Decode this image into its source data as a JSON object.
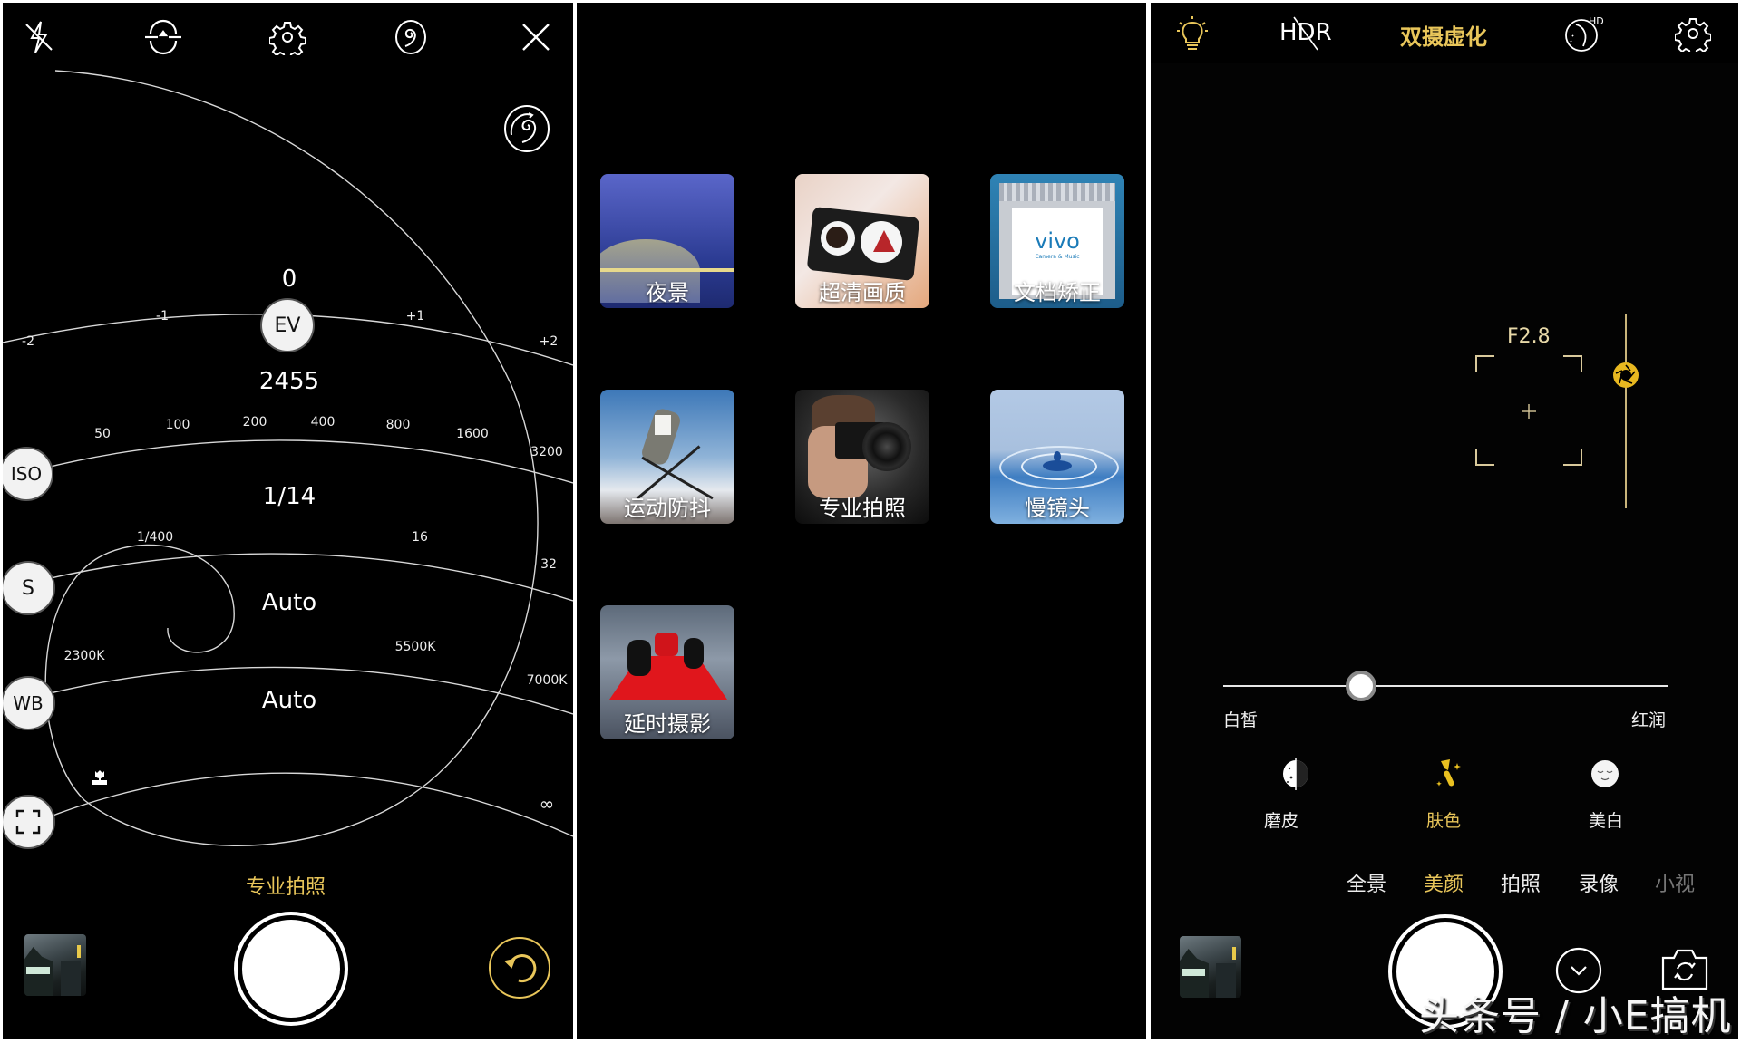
{
  "colors": {
    "accent_gold": "#e9c65a",
    "background": "#000000",
    "divider": "#ffffff"
  },
  "panel_pro": {
    "top_icons": [
      "flash-off-icon",
      "flip-exposure-icon",
      "settings-icon",
      "spiral-mode-icon",
      "close-icon"
    ],
    "spiral_reset_icon": "spiral-reset-icon",
    "ev": {
      "label": "EV",
      "value": "0",
      "ticks": [
        "-2",
        "-1",
        "+1",
        "+2"
      ]
    },
    "iso": {
      "label": "ISO",
      "value": "2455",
      "ticks": [
        "50",
        "100",
        "200",
        "400",
        "800",
        "1600",
        "3200"
      ]
    },
    "shutter": {
      "label": "S",
      "value": "1/14",
      "ticks": [
        "1/400",
        "16",
        "32"
      ]
    },
    "wb": {
      "label": "WB",
      "value": "Auto",
      "ticks": [
        "2300K",
        "5500K",
        "7000K"
      ]
    },
    "focus": {
      "label": "focus",
      "value": "Auto",
      "ticks": [
        "macro",
        "∞"
      ]
    },
    "mode_label": "专业拍照",
    "shutter_button": "shutter-button",
    "reset_icon": "reset-icon"
  },
  "panel_modes": {
    "tiles": [
      {
        "label": "夜景"
      },
      {
        "label": "超清画质"
      },
      {
        "label": "文档矫正",
        "inner_text": "vivo",
        "inner_sub": "Camera & Music"
      },
      {
        "label": "运动防抖"
      },
      {
        "label": "专业拍照"
      },
      {
        "label": "慢镜头"
      },
      {
        "label": "延时摄影"
      }
    ]
  },
  "panel_beauty": {
    "top": {
      "hdr_label": "HDR",
      "title": "双摄虚化",
      "hd_label": "HD"
    },
    "aperture": {
      "value": "F2.8",
      "position": 0.3
    },
    "skin_slider": {
      "left_label": "白皙",
      "right_label": "红润",
      "value": 0.42
    },
    "beauty_options": [
      {
        "label": "磨皮",
        "icon": "smoothing-icon",
        "active": false
      },
      {
        "label": "肤色",
        "icon": "skin-tone-brush-icon",
        "active": true
      },
      {
        "label": "美白",
        "icon": "whitening-face-icon",
        "active": false
      }
    ],
    "modes": [
      {
        "label": "全景",
        "active": false
      },
      {
        "label": "美颜",
        "active": true
      },
      {
        "label": "拍照",
        "active": false
      },
      {
        "label": "录像",
        "active": false
      },
      {
        "label": "小视",
        "active": false
      }
    ],
    "watermark": "头条号 / 小E搞机"
  }
}
